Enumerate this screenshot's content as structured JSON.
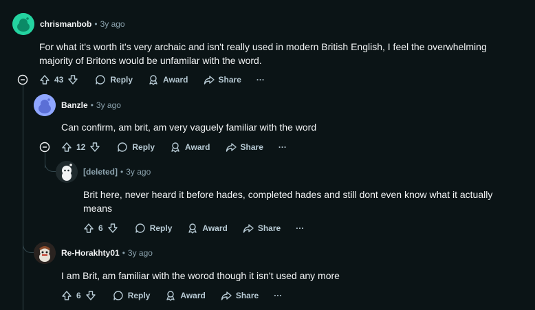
{
  "comments": [
    {
      "username": "chrismanbob",
      "age": "3y ago",
      "body_lines": [
        "For what it's worth it's very archaic and isn't really used in modern British English, I feel the overwhelming",
        "majority of Britons would be unfamilar with the word."
      ],
      "score": "43",
      "reply": "Reply",
      "award": "Award",
      "share": "Share",
      "more": "···"
    },
    {
      "username": "Banzle",
      "age": "3y ago",
      "body_lines": [
        "Can confirm, am brit, am very vaguely familiar with the word"
      ],
      "score": "12",
      "reply": "Reply",
      "award": "Award",
      "share": "Share",
      "more": "···"
    },
    {
      "username": "[deleted]",
      "age": "3y ago",
      "body_lines": [
        "Brit here, never heard it before hades, completed hades and still dont even know what it actually",
        "means"
      ],
      "score": "6",
      "reply": "Reply",
      "award": "Award",
      "share": "Share",
      "more": "···"
    },
    {
      "username": "Re-Horakhty01",
      "age": "3y ago",
      "body_lines": [
        "I am Brit, am familiar with the worod though it isn't used any more"
      ],
      "score": "6",
      "reply": "Reply",
      "award": "Award",
      "share": "Share",
      "more": "···"
    }
  ],
  "separator": "•",
  "colors": {
    "background": "#0b1416",
    "text": "#f2f4f5",
    "meta": "#8ba2ad",
    "thread_line": "#33464c",
    "avatar_1": "#24d3a0",
    "avatar_2": "#8fa6ff"
  }
}
